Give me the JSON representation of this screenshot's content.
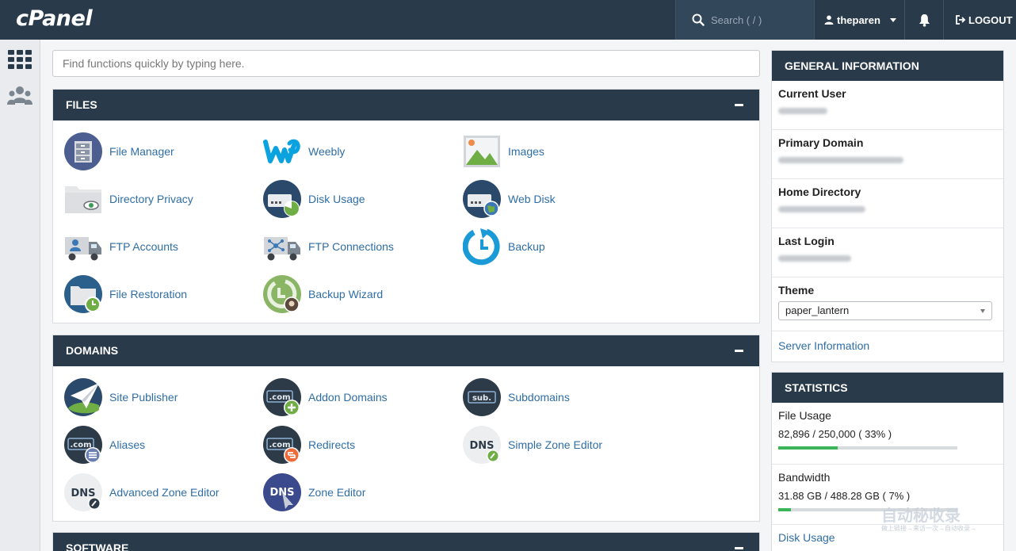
{
  "app": {
    "logo": "cPanel"
  },
  "topbar": {
    "search_placeholder": "Search ( / )",
    "username": "theparen",
    "logout_label": "LOGOUT"
  },
  "quick_find": {
    "placeholder": "Find functions quickly by typing here."
  },
  "files": {
    "title": "FILES",
    "items": [
      {
        "label": "File Manager",
        "icon": "file-manager-icon"
      },
      {
        "label": "Weebly",
        "icon": "weebly-icon"
      },
      {
        "label": "Images",
        "icon": "images-icon"
      },
      {
        "label": "Directory Privacy",
        "icon": "directory-privacy-icon"
      },
      {
        "label": "Disk Usage",
        "icon": "disk-usage-icon"
      },
      {
        "label": "Web Disk",
        "icon": "web-disk-icon"
      },
      {
        "label": "FTP Accounts",
        "icon": "ftp-accounts-icon"
      },
      {
        "label": "FTP Connections",
        "icon": "ftp-connections-icon"
      },
      {
        "label": "Backup",
        "icon": "backup-icon"
      },
      {
        "label": "File Restoration",
        "icon": "file-restoration-icon"
      },
      {
        "label": "Backup Wizard",
        "icon": "backup-wizard-icon"
      }
    ]
  },
  "domains": {
    "title": "DOMAINS",
    "items": [
      {
        "label": "Site Publisher",
        "icon": "site-publisher-icon"
      },
      {
        "label": "Addon Domains",
        "icon": "addon-domains-icon"
      },
      {
        "label": "Subdomains",
        "icon": "subdomains-icon"
      },
      {
        "label": "Aliases",
        "icon": "aliases-icon"
      },
      {
        "label": "Redirects",
        "icon": "redirects-icon"
      },
      {
        "label": "Simple Zone Editor",
        "icon": "simple-zone-editor-icon"
      },
      {
        "label": "Advanced Zone Editor",
        "icon": "advanced-zone-editor-icon"
      },
      {
        "label": "Zone Editor",
        "icon": "zone-editor-icon"
      }
    ]
  },
  "software": {
    "title": "SOFTWARE"
  },
  "general_info": {
    "title": "GENERAL INFORMATION",
    "current_user_label": "Current User",
    "primary_domain_label": "Primary Domain",
    "home_directory_label": "Home Directory",
    "last_login_label": "Last Login",
    "theme_label": "Theme",
    "theme_value": "paper_lantern",
    "server_info_link": "Server Information"
  },
  "statistics": {
    "title": "STATISTICS",
    "file_usage_label": "File Usage",
    "file_usage_value": "82,896 / 250,000 ( 33% )",
    "file_usage_fraction": 0.33,
    "bandwidth_label": "Bandwidth",
    "bandwidth_value": "31.88 GB / 488.28 GB ( 7% )",
    "bandwidth_fraction": 0.07,
    "disk_usage_label": "Disk Usage"
  },
  "watermark": {
    "text": "自动秘收录",
    "subtext": "做上链接→来访一次→自动收录→"
  },
  "colors": {
    "header": "#293a4a",
    "link": "#2f6ea5",
    "progress": "#3cb55a"
  }
}
